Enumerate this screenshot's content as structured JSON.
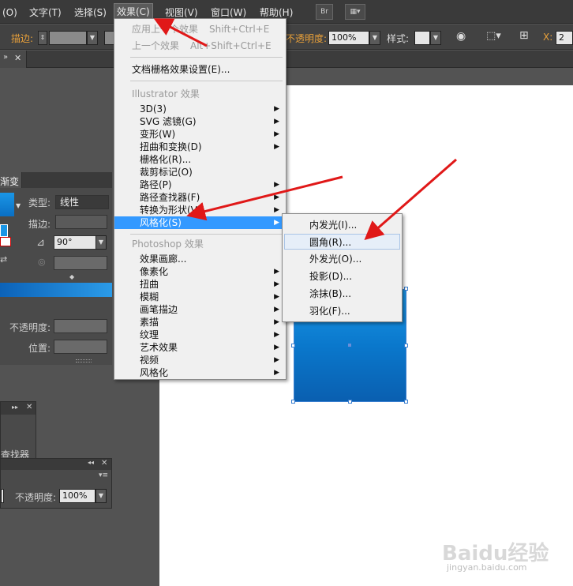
{
  "menubar": {
    "items": [
      "(O)",
      "文字(T)",
      "选择(S)",
      "效果(C)",
      "视图(V)",
      "窗口(W)",
      "帮助(H)"
    ],
    "bridge_label": "Br"
  },
  "toolbar": {
    "stroke_label": "描边:",
    "opacity_label": "不透明度:",
    "opacity_value": "100%",
    "style_label": "样式:",
    "x_label": "X:",
    "x_value": "2"
  },
  "effect_menu": {
    "apply_last": {
      "label": "应用上一个效果",
      "shortcut": "Shift+Ctrl+E"
    },
    "last_effect": {
      "label": "上一个效果",
      "shortcut": "Alt+Shift+Ctrl+E"
    },
    "raster_settings": "文档栅格效果设置(E)...",
    "illustrator_header": "Illustrator 效果",
    "illustrator_items": [
      "3D(3)",
      "SVG 滤镜(G)",
      "变形(W)",
      "扭曲和变换(D)",
      "栅格化(R)...",
      "裁剪标记(O)",
      "路径(P)",
      "路径查找器(F)",
      "转换为形状(V)",
      "风格化(S)"
    ],
    "photoshop_header": "Photoshop 效果",
    "photoshop_items": [
      "效果画廊...",
      "像素化",
      "扭曲",
      "模糊",
      "画笔描边",
      "素描",
      "纹理",
      "艺术效果",
      "视频",
      "风格化"
    ]
  },
  "stylize_submenu": {
    "items": [
      "内发光(I)...",
      "圆角(R)...",
      "外发光(O)...",
      "投影(D)...",
      "涂抹(B)...",
      "羽化(F)..."
    ]
  },
  "gradient_panel": {
    "tab": "渐变",
    "type_label": "类型:",
    "type_value": "线性",
    "stroke_label": "描边:",
    "angle_value": "90°",
    "opacity_label": "不透明度:",
    "position_label": "位置:"
  },
  "pathfinder_panel": {
    "label": "查找器"
  },
  "transparency_panel": {
    "opacity_label": "不透明度:",
    "opacity_value": "100%"
  },
  "watermark": {
    "brand": "Baidu经验",
    "url": "jingyan.baidu.com"
  },
  "colors": {
    "highlight": "#3399ff",
    "shape_top": "#1a96e6",
    "shape_bottom": "#0a5fb0",
    "arrow": "#e01818"
  }
}
